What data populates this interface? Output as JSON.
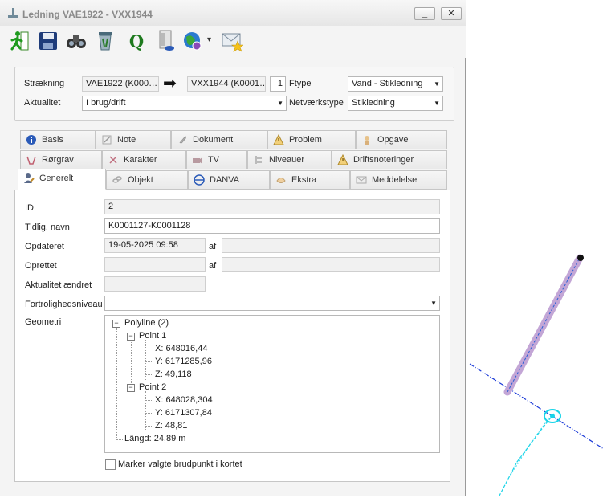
{
  "window": {
    "title": "Ledning VAE1922 - VXX1944",
    "minimize_label": "_",
    "close_label": "✕"
  },
  "toolbar": {
    "items": [
      {
        "icon": "exit-running-man-icon"
      },
      {
        "icon": "save-floppy-icon"
      },
      {
        "icon": "binoculars-icon"
      },
      {
        "icon": "recycle-bin-icon"
      },
      {
        "icon": "query-q-icon"
      },
      {
        "icon": "report-document-icon"
      },
      {
        "icon": "globe-web-icon"
      },
      {
        "icon": "mail-star-icon"
      }
    ],
    "q_label": "Q",
    "dropdown_arrow": "▾"
  },
  "header": {
    "straekning_label": "Strækning",
    "from_value": "VAE1922 (K000…",
    "arrow": "➡",
    "to_value": "VXX1944 (K0001…",
    "count_value": "1",
    "ftype_label": "Ftype",
    "ftype_value": "Vand - Stikledning",
    "aktualitet_label": "Aktualitet",
    "aktualitet_value": "I brug/drift",
    "netvaerkstype_label": "Netværkstype",
    "netvaerkstype_value": "Stikledning"
  },
  "tabs": {
    "row1": [
      "Basis",
      "Note",
      "Dokument",
      "Problem",
      "Opgave"
    ],
    "row2": [
      "Rørgrav",
      "Karakter",
      "TV",
      "Niveauer",
      "Driftsnoteringer"
    ],
    "row3": [
      "Generelt",
      "Objekt",
      "DANVA",
      "Ekstra",
      "Meddelelse"
    ],
    "active": "Generelt"
  },
  "general": {
    "id_label": "ID",
    "id_value": "2",
    "tidlig_navn_label": "Tidlig. navn",
    "tidlig_navn_value": "K0001127-K0001128",
    "opdateret_label": "Opdateret",
    "opdateret_value": "19-05-2025 09:58",
    "af_label": "af",
    "opdateret_af_value": "",
    "oprettet_label": "Oprettet",
    "oprettet_value": "",
    "oprettet_af_value": "",
    "aktualitet_aendret_label": "Aktualitet ændret",
    "aktualitet_aendret_value": "",
    "fortrolighed_label": "Fortrolighedsniveau",
    "fortrolighed_value": "",
    "geometri_label": "Geometri"
  },
  "geometry_tree": {
    "root": "Polyline (2)",
    "points": [
      {
        "label": "Point 1",
        "x": "X: 648016,44",
        "y": "Y: 6171285,96",
        "z": "Z: 49,118"
      },
      {
        "label": "Point 2",
        "x": "X: 648028,304",
        "y": "Y: 6171307,84",
        "z": "Z: 48,81"
      }
    ],
    "length": "Längd: 24,89 m",
    "expand_symbol": "−"
  },
  "checkbox": {
    "label": "Marker valgte brudpunkt i kortet",
    "checked": false
  },
  "colors": {
    "pipe": "#c3a6d6",
    "pipe_center": "#2a5fd6",
    "dashed_line": "#1a3ad8",
    "cyan_line": "#19d4e8"
  }
}
